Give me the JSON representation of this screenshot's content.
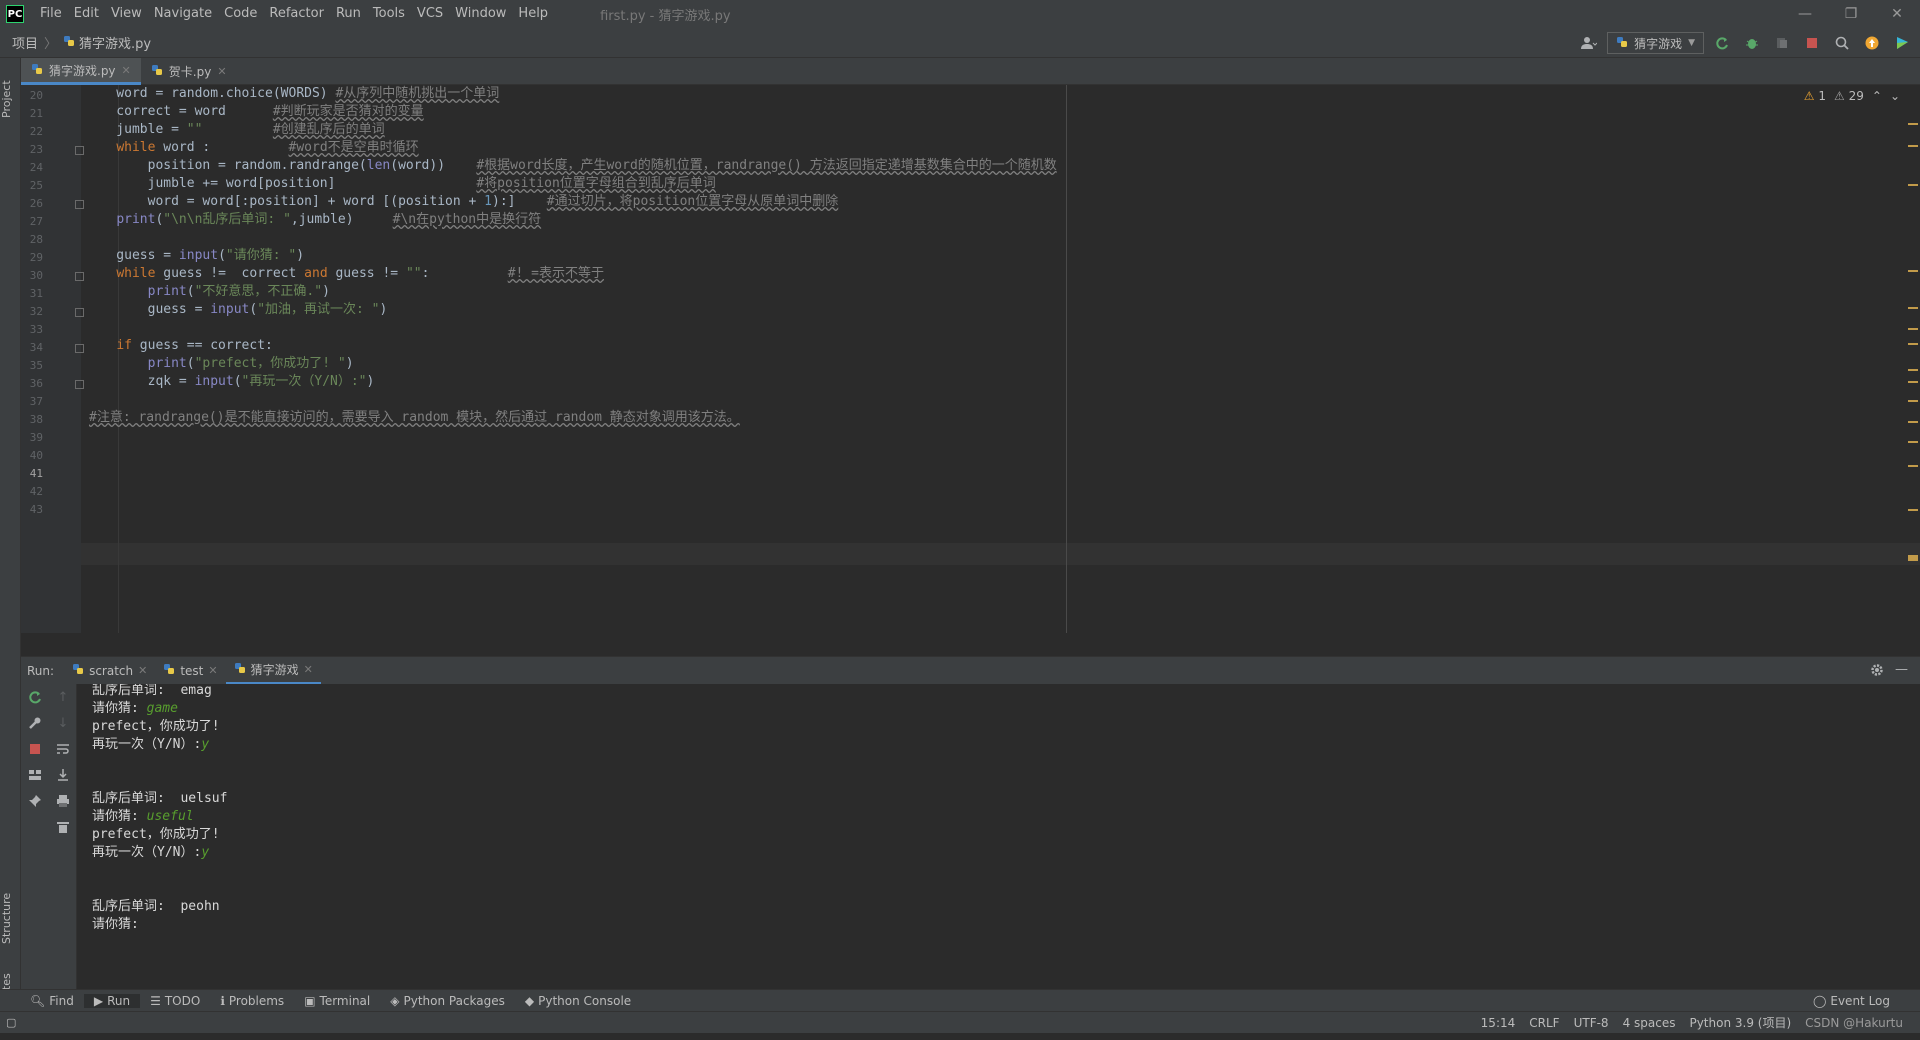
{
  "titlebar": {
    "logo": "PC",
    "menu": [
      "File",
      "Edit",
      "View",
      "Navigate",
      "Code",
      "Refactor",
      "Run",
      "Tools",
      "VCS",
      "Window",
      "Help"
    ],
    "title": "first.py - 猜字游戏.py",
    "minimize": "—",
    "restore": "❐",
    "close": "✕"
  },
  "navbar": {
    "project": "项目",
    "file": "猜字游戏.py",
    "run_config": "猜字游戏"
  },
  "left_strip": {
    "project": "Project",
    "structure": "Structure",
    "favorites": "Favorites"
  },
  "tabs": [
    {
      "label": "猜字游戏.py",
      "active": true
    },
    {
      "label": "贺卡.py",
      "active": false
    }
  ],
  "editor": {
    "warnings": "1",
    "weak_warnings": "29",
    "lines": [
      {
        "n": "20",
        "t": "    word = random.choice(WORDS) ",
        "c": "#从序列中随机挑出一个单词"
      },
      {
        "n": "21",
        "t": "    correct = word      ",
        "c": "#判断玩家是否猜对的变量"
      },
      {
        "n": "22",
        "t": "    jumble = \"\"         ",
        "c": "#创建乱序后的单词"
      },
      {
        "n": "23",
        "t": "    while word :          ",
        "c": "#word不是空串时循环"
      },
      {
        "n": "24",
        "t": "        position = random.randrange(len(word))    ",
        "c": "#根据word长度，产生word的随机位置，randrange() 方法返回指定递增基数集合中的一个随机数"
      },
      {
        "n": "25",
        "t": "        jumble += word[position]                  ",
        "c": "#将position位置字母组合到乱序后单词"
      },
      {
        "n": "26",
        "t": "        word = word[:position] + word [(position + 1):]    ",
        "c": "#通过切片，将position位置字母从原单词中删除"
      },
      {
        "n": "27",
        "t": "    print(\"\\n\\n乱序后单词: \",jumble)     ",
        "c": "#\\n在python中是换行符"
      },
      {
        "n": "28",
        "t": "",
        "c": ""
      },
      {
        "n": "29",
        "t": "    guess = input(\"请你猜: \")",
        "c": ""
      },
      {
        "n": "30",
        "t": "    while guess !=  correct and guess != \"\":          ",
        "c": "#! =表示不等于"
      },
      {
        "n": "31",
        "t": "        print(\"不好意思，不正确.\")",
        "c": ""
      },
      {
        "n": "32",
        "t": "        guess = input(\"加油，再试一次: \")",
        "c": ""
      },
      {
        "n": "33",
        "t": "",
        "c": ""
      },
      {
        "n": "34",
        "t": "    if guess == correct:",
        "c": ""
      },
      {
        "n": "35",
        "t": "        print(\"prefect，你成功了! \")",
        "c": ""
      },
      {
        "n": "36",
        "t": "        zqk = input(\"再玩一次（Y/N）:\")",
        "c": ""
      },
      {
        "n": "37",
        "t": "",
        "c": ""
      },
      {
        "n": "38",
        "t": "",
        "c": "#注意: randrange()是不能直接访问的，需要导入 random 模块，然后通过 random 静态对象调用该方法。"
      },
      {
        "n": "39",
        "t": "",
        "c": ""
      },
      {
        "n": "40",
        "t": "",
        "c": ""
      },
      {
        "n": "41",
        "t": "",
        "c": ""
      },
      {
        "n": "42",
        "t": "",
        "c": ""
      },
      {
        "n": "43",
        "t": "",
        "c": ""
      }
    ]
  },
  "run": {
    "label": "Run:",
    "tabs": [
      {
        "label": "scratch",
        "active": false
      },
      {
        "label": "test",
        "active": false
      },
      {
        "label": "猜字游戏",
        "active": true
      }
    ],
    "console": [
      {
        "p": "乱序后单词:  emag",
        "u": ""
      },
      {
        "p": "请你猜: ",
        "u": "game"
      },
      {
        "p": "prefect，你成功了!",
        "u": ""
      },
      {
        "p": "再玩一次（Y/N）:",
        "u": "y"
      },
      {
        "p": "",
        "u": ""
      },
      {
        "p": "",
        "u": ""
      },
      {
        "p": "乱序后单词:  uelsuf",
        "u": ""
      },
      {
        "p": "请你猜: ",
        "u": "useful"
      },
      {
        "p": "prefect，你成功了!",
        "u": ""
      },
      {
        "p": "再玩一次（Y/N）:",
        "u": "y"
      },
      {
        "p": "",
        "u": ""
      },
      {
        "p": "",
        "u": ""
      },
      {
        "p": "乱序后单词:  peohn",
        "u": ""
      },
      {
        "p": "请你猜: ",
        "u": ""
      }
    ]
  },
  "bottom_tools": [
    "Find",
    "Run",
    "TODO",
    "Problems",
    "Terminal",
    "Python Packages",
    "Python Console"
  ],
  "event_log": "Event Log",
  "status": {
    "position": "15:14",
    "line_sep": "CRLF",
    "encoding": "UTF-8",
    "indent": "4 spaces",
    "interpreter": "Python 3.9 (项目)",
    "watermark": "CSDN @Hakurtu"
  }
}
